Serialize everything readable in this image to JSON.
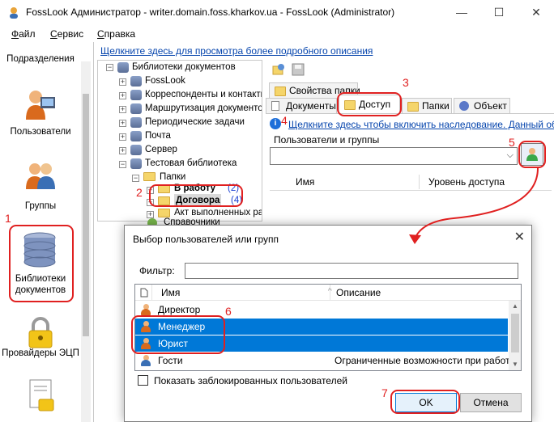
{
  "window": {
    "title": "FossLook Администратор - writer.domain.foss.kharkov.ua - FossLook (Administrator)",
    "minimize": "—",
    "maximize": "☐",
    "close": "✕"
  },
  "menu": [
    "Файл",
    "Сервис",
    "Справка"
  ],
  "hint_link": "Щелкните здесь для просмотра более подробного описания",
  "left_panel": {
    "items": [
      {
        "label": "Подразделения",
        "icon": "departments-icon"
      },
      {
        "label": "Пользователи",
        "icon": "user-icon"
      },
      {
        "label": "Группы",
        "icon": "group-icon"
      },
      {
        "label": "Библиотеки документов",
        "icon": "database-icon"
      },
      {
        "label": "Провайдеры ЭЦП",
        "icon": "lock-icon"
      },
      {
        "label": "",
        "icon": "document-lock-icon"
      }
    ]
  },
  "tree": {
    "root": "Библиотеки документов",
    "nodes": [
      {
        "label": "FossLook"
      },
      {
        "label": "Корреспонденты и контакты"
      },
      {
        "label": "Маршрутизация документов"
      },
      {
        "label": "Периодические задачи"
      },
      {
        "label": "Почта"
      },
      {
        "label": "Сервер"
      },
      {
        "label": "Тестовая библиотека"
      },
      {
        "label": "Папки"
      },
      {
        "label": "В работу",
        "count": "(2)"
      },
      {
        "label": "Договора",
        "count": "(4)"
      },
      {
        "label": "Акт выполненных работ"
      },
      {
        "label": "Справочники"
      }
    ]
  },
  "tabs": {
    "top": "Свойства папки",
    "row": [
      "Документы",
      "Доступ",
      "Папки",
      "Объект"
    ],
    "active": "Доступ"
  },
  "inheritance_link": "Щелкните здесь чтобы включить наследование. Данный объект",
  "users_groups": {
    "label": "Пользователи и группы",
    "columns": [
      "Имя",
      "Уровень доступа"
    ]
  },
  "dialog": {
    "title": "Выбор пользователей или групп",
    "filter_label": "Фильтр:",
    "filter_value": "",
    "columns": [
      "Имя",
      "Описание"
    ],
    "rows": [
      {
        "name": "Директор",
        "description": "",
        "selected": false
      },
      {
        "name": "Менеджер",
        "description": "",
        "selected": true
      },
      {
        "name": "Юрист",
        "description": "",
        "selected": true
      },
      {
        "name": "Гости",
        "description": "Ограниченные возможности при работ...",
        "selected": false
      }
    ],
    "show_blocked_label": "Показать заблокированных пользователей",
    "show_blocked_checked": false,
    "ok": "OK",
    "cancel": "Отмена"
  },
  "annotations": [
    "1",
    "2",
    "3",
    "4",
    "5",
    "6",
    "7"
  ],
  "colors": {
    "selection": "#0078d7",
    "link": "#0645ad",
    "annotation": "#e02020"
  }
}
